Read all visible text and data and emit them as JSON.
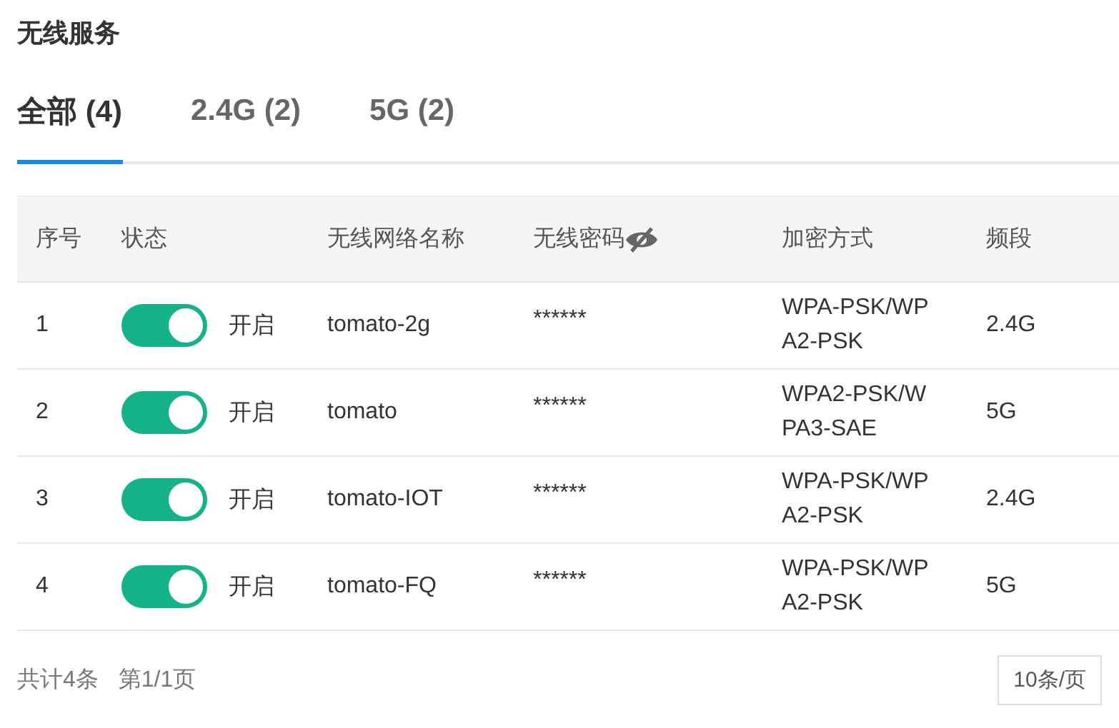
{
  "title": "无线服务",
  "tabs": [
    {
      "label": "全部 (4)",
      "selected": true
    },
    {
      "label": "2.4G (2)",
      "selected": false
    },
    {
      "label": "5G (2)",
      "selected": false
    }
  ],
  "table": {
    "columns": [
      "序号",
      "状态",
      "无线网络名称",
      "无线密码",
      "加密方式",
      "频段"
    ],
    "rows": [
      {
        "index": "1",
        "on": true,
        "status": "开启",
        "ssid": "tomato-2g",
        "password": "******",
        "encryption": "WPA-PSK/WPA2-PSK",
        "band": "2.4G"
      },
      {
        "index": "2",
        "on": true,
        "status": "开启",
        "ssid": "tomato",
        "password": "******",
        "encryption": "WPA2-PSK/WPA3-SAE",
        "band": "5G"
      },
      {
        "index": "3",
        "on": true,
        "status": "开启",
        "ssid": "tomato-IOT",
        "password": "******",
        "encryption": "WPA-PSK/WPA2-PSK",
        "band": "2.4G"
      },
      {
        "index": "4",
        "on": true,
        "status": "开启",
        "ssid": "tomato-FQ",
        "password": "******",
        "encryption": "WPA-PSK/WPA2-PSK",
        "band": "5G"
      }
    ]
  },
  "pagination": {
    "total": "共计4条",
    "page": "第1/1页",
    "page_size": "10条/页"
  }
}
